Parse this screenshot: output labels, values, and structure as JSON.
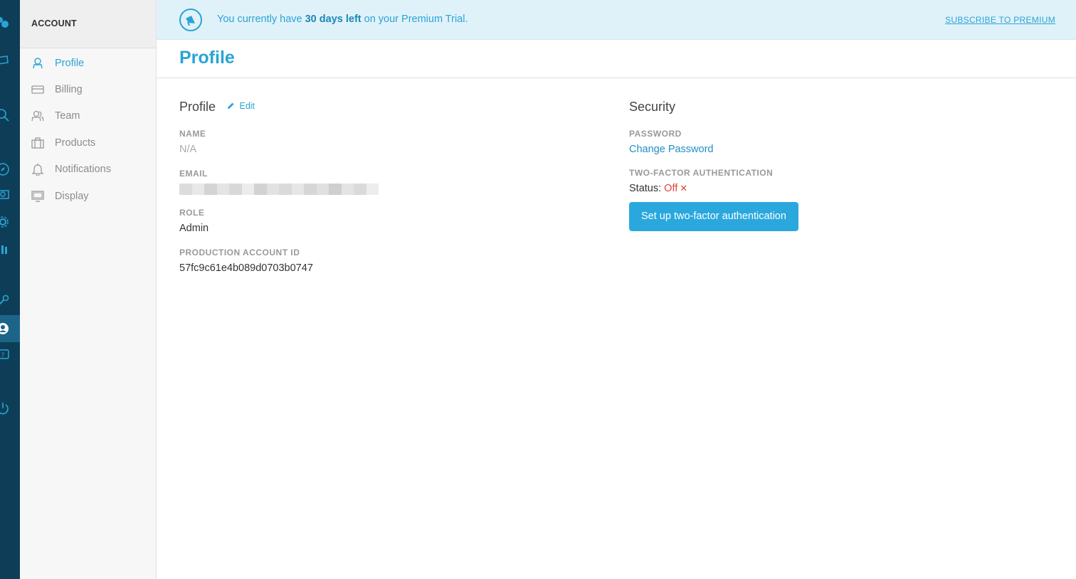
{
  "colors": {
    "accent": "#2aa3d5",
    "rail_bg": "#0e3e57",
    "banner_bg": "#e0f2f9",
    "status_off": "#e0433b",
    "button_bg": "#2aa8de"
  },
  "rail": {
    "icons": [
      "logo-icon",
      "inbox-icon",
      "search-icon",
      "compass-icon",
      "dashboard-icon",
      "gear-icon",
      "chart-icon",
      "tools-icon",
      "user-icon",
      "help-icon",
      "power-icon"
    ],
    "active": "user-icon"
  },
  "sidebar": {
    "header": "ACCOUNT",
    "items": [
      {
        "label": "Profile",
        "icon": "user-outline-icon",
        "active": true
      },
      {
        "label": "Billing",
        "icon": "credit-card-icon",
        "active": false
      },
      {
        "label": "Team",
        "icon": "team-icon",
        "active": false
      },
      {
        "label": "Products",
        "icon": "briefcase-icon",
        "active": false
      },
      {
        "label": "Notifications",
        "icon": "bell-icon",
        "active": false
      },
      {
        "label": "Display",
        "icon": "monitor-icon",
        "active": false
      }
    ]
  },
  "banner": {
    "text_before": "You currently have ",
    "text_bold": "30 days left",
    "text_after": " on your Premium Trial.",
    "link": "SUBSCRIBE TO PREMIUM"
  },
  "page": {
    "title": "Profile"
  },
  "profile": {
    "title": "Profile",
    "edit_label": "Edit",
    "name_label": "NAME",
    "name_value": "N/A",
    "email_label": "EMAIL",
    "role_label": "ROLE",
    "role_value": "Admin",
    "account_id_label": "PRODUCTION ACCOUNT ID",
    "account_id_value": "57fc9c61e4b089d0703b0747"
  },
  "security": {
    "title": "Security",
    "password_label": "PASSWORD",
    "change_password": "Change Password",
    "tfa_label": "TWO-FACTOR AUTHENTICATION",
    "status_label": "Status:",
    "status_value": "Off",
    "status_mark": "✕",
    "setup_button": "Set up two-factor authentication"
  }
}
